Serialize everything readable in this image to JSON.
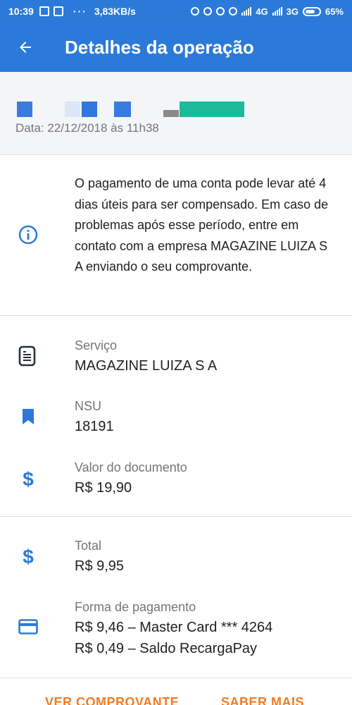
{
  "status_bar": {
    "time": "10:39",
    "dots": "···",
    "speed": "3,83KB/s",
    "network_4g": "4G",
    "network_3g": "3G",
    "battery": "65%"
  },
  "app_bar": {
    "title": "Detalhes da operação"
  },
  "header": {
    "date": "Data: 22/12/2018 às 11h38"
  },
  "info": {
    "text": "O pagamento de uma conta pode levar até 4 dias úteis para ser compensado. Em caso de problemas após esse período, entre em contato com a empresa MAGAZINE LUIZA S A enviando o seu comprovante."
  },
  "details": {
    "servico_label": "Serviço",
    "servico_value": "MAGAZINE LUIZA S A",
    "nsu_label": "NSU",
    "nsu_value": "18191",
    "valor_label": "Valor do documento",
    "valor_value": "R$ 19,90",
    "total_label": "Total",
    "total_value": "R$ 9,95",
    "forma_label": "Forma de pagamento",
    "forma_line1": "R$ 9,46 – Master Card *** 4264",
    "forma_line2": "R$ 0,49 – Saldo RecargaPay"
  },
  "actions": {
    "ver_comprovante": "VER COMPROVANTE",
    "saber_mais": "SABER MAIS"
  },
  "colors": {
    "primary": "#2b7ad9",
    "accent": "#f47b20",
    "redaction_teal": "#1db99a"
  },
  "icons": {
    "back": "arrow-left-icon",
    "info": "info-circle-icon",
    "service": "receipt-icon",
    "nsu": "bookmark-icon",
    "valor": "dollar-icon",
    "total": "dollar-icon",
    "forma": "credit-card-icon"
  }
}
